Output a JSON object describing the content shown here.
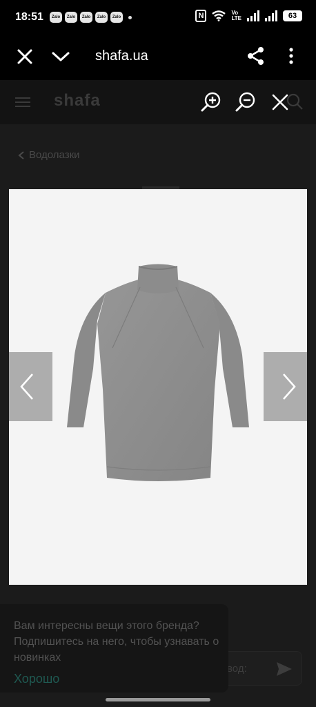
{
  "status_bar": {
    "time": "18:51",
    "zalo_label": "Zalo",
    "volte_label": "Vo\nLTE",
    "battery": "63"
  },
  "browser": {
    "url": "shafa.ua"
  },
  "site": {
    "logo": "shafa",
    "breadcrumb": "Водолазки"
  },
  "toast": {
    "message": "Вам интересны вещи этого бренда? Подпишитесь на него, чтобы узнавать о новинках",
    "ok_label": "Хорошо"
  },
  "behind_input": {
    "placeholder_fragment": "вод:"
  },
  "colors": {
    "accent_ok": "#1f5a52",
    "sweater": "#8e8e8e",
    "photo_bg": "#f4f4f4"
  }
}
